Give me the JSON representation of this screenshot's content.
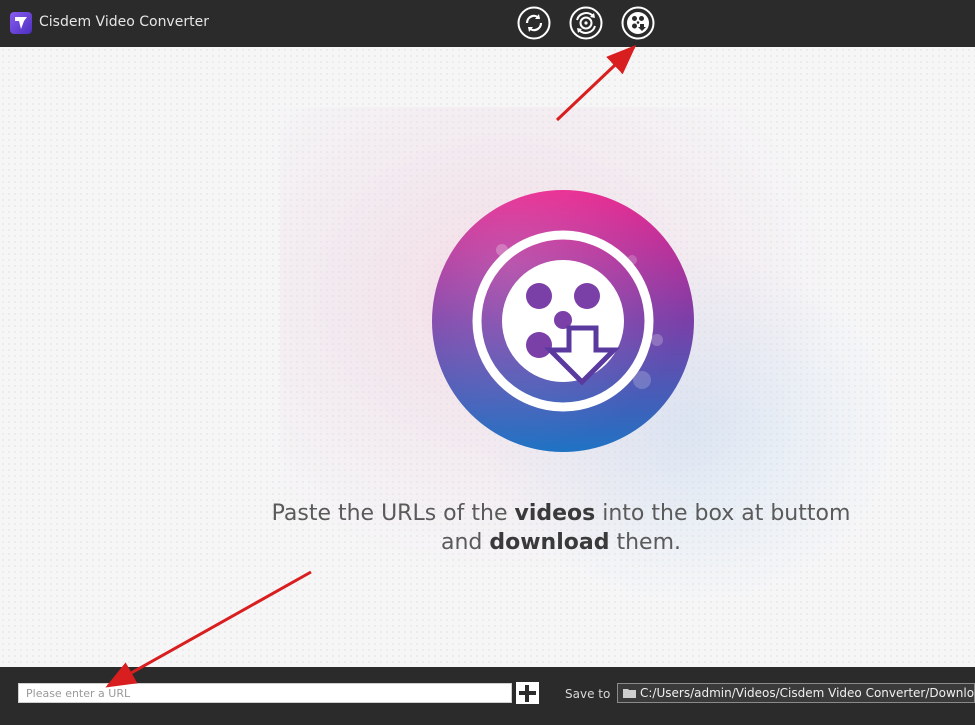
{
  "app": {
    "title": "Cisdem Video Converter"
  },
  "toolbar": {
    "modes": [
      {
        "name": "convert-mode-icon"
      },
      {
        "name": "rip-dvd-mode-icon"
      },
      {
        "name": "download-mode-icon",
        "active": true
      }
    ]
  },
  "main": {
    "hint_prefix": "Paste the URLs of the ",
    "hint_bold1": "videos",
    "hint_middle": " into the box at buttom",
    "hint_line2_prefix": "and ",
    "hint_bold2": "download",
    "hint_suffix": " them."
  },
  "bottom": {
    "url_placeholder": "Please enter a URL",
    "url_value": "",
    "save_label": "Save to",
    "save_path": "C:/Users/admin/Videos/Cisdem Video Converter/Download"
  },
  "colors": {
    "bar_bg": "#2b2b2b",
    "logo_gradient_top": "#e8208c",
    "logo_gradient_mid": "#7b3fa8",
    "logo_gradient_bottom": "#1f73c4",
    "annotation_arrow": "#d81e1e"
  }
}
